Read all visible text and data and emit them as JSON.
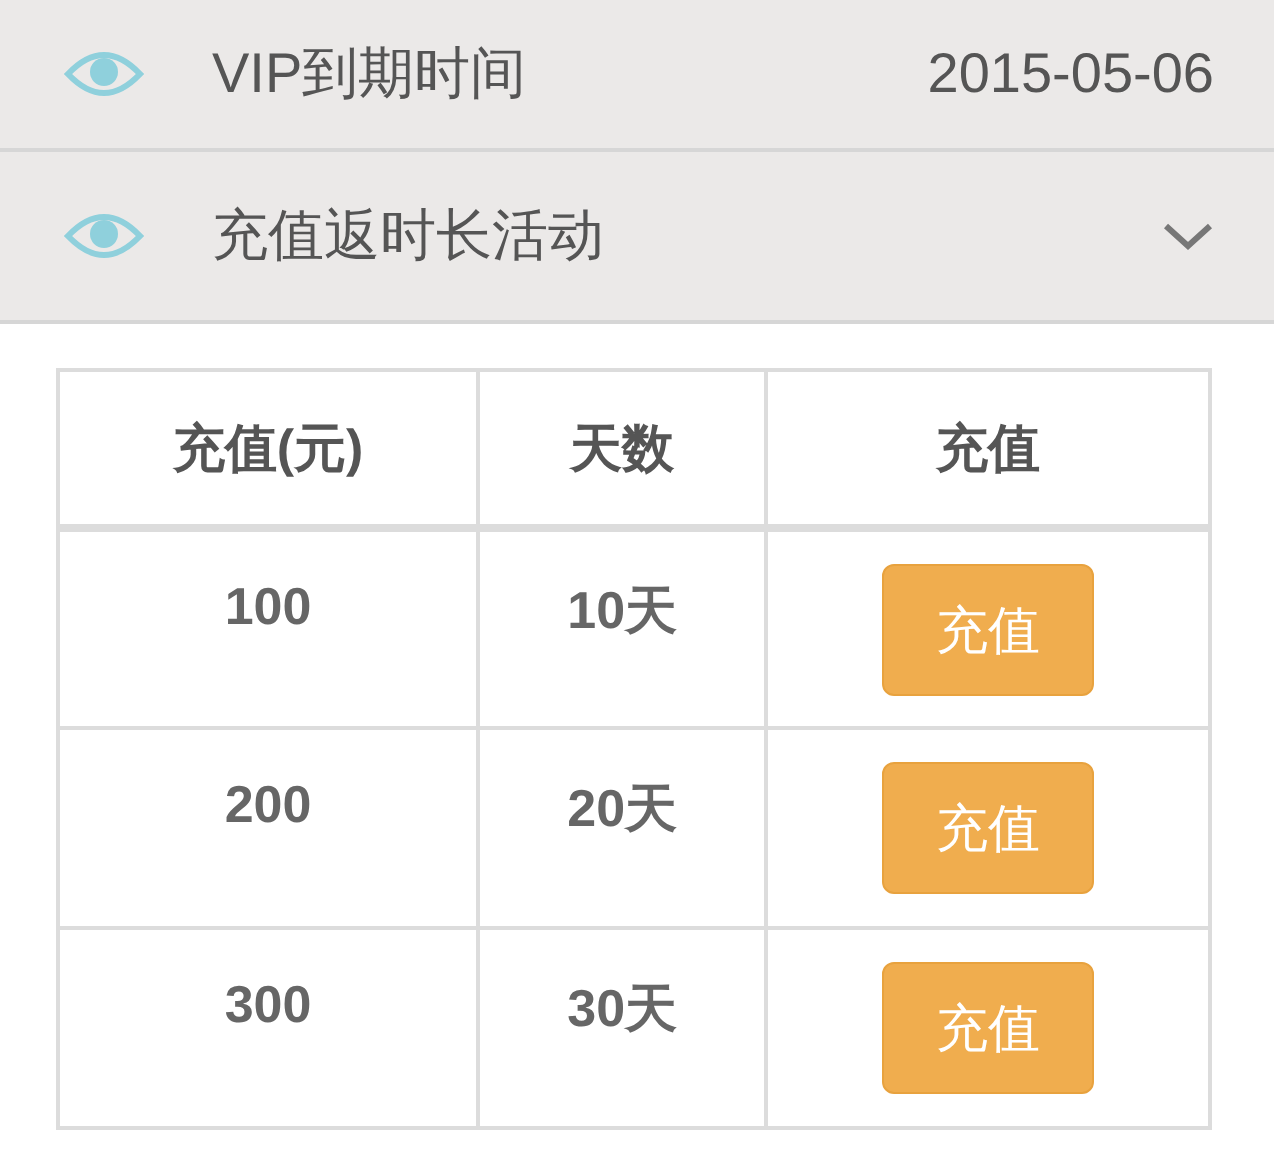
{
  "info_rows": [
    {
      "label": "VIP到期时间",
      "value": "2015-05-06"
    }
  ],
  "promotion": {
    "label": "充值返时长活动",
    "expanded": true,
    "table": {
      "columns": [
        "充值(元)",
        "天数",
        "充值"
      ],
      "rows": [
        {
          "amount": "100",
          "days": "10天",
          "button": "充值"
        },
        {
          "amount": "200",
          "days": "20天",
          "button": "充值"
        },
        {
          "amount": "300",
          "days": "30天",
          "button": "充值"
        }
      ]
    }
  }
}
